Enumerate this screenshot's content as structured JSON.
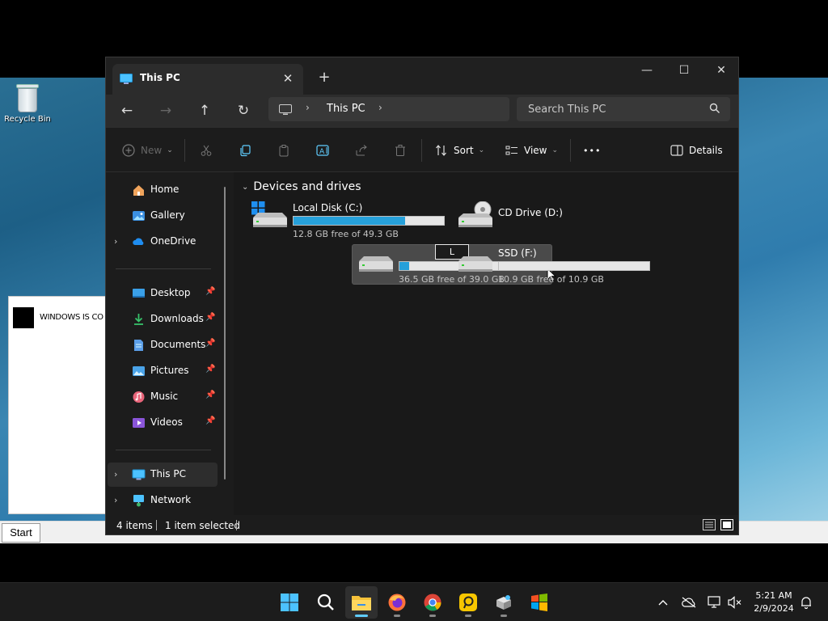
{
  "desktop": {
    "recycle_bin_label": "Recycle Bin",
    "bg_window_text": "WINDOWS IS CO",
    "start_button": "Start"
  },
  "window": {
    "tab_title": "This PC",
    "tab_close": "✕",
    "new_tab": "+",
    "minimize": "—",
    "maximize": "☐",
    "close": "✕"
  },
  "address": {
    "back": "←",
    "forward": "→",
    "up": "↑",
    "refresh": "↻",
    "chevron": "›",
    "breadcrumb": "This PC",
    "search_placeholder": "Search This PC"
  },
  "toolbar": {
    "new_label": "New",
    "sort_label": "Sort",
    "view_label": "View",
    "more_label": "•••",
    "details_label": "Details",
    "dropdown": "⌄"
  },
  "sidebar": {
    "items": [
      {
        "label": "Home",
        "icon": "home-icon"
      },
      {
        "label": "Gallery",
        "icon": "gallery-icon"
      },
      {
        "label": "OneDrive",
        "icon": "onedrive-icon"
      },
      {
        "label": "Desktop",
        "icon": "desktop-folder-icon",
        "pinned": true
      },
      {
        "label": "Downloads",
        "icon": "downloads-icon",
        "pinned": true
      },
      {
        "label": "Documents",
        "icon": "documents-icon",
        "pinned": true
      },
      {
        "label": "Pictures",
        "icon": "pictures-icon",
        "pinned": true
      },
      {
        "label": "Music",
        "icon": "music-icon",
        "pinned": true
      },
      {
        "label": "Videos",
        "icon": "videos-icon",
        "pinned": true
      },
      {
        "label": "This PC",
        "icon": "this-pc-icon",
        "selected": true
      },
      {
        "label": "Network",
        "icon": "network-icon"
      }
    ],
    "expander": "›",
    "pin": "📌"
  },
  "content": {
    "group_title": "Devices and drives",
    "group_chevron": "⌄",
    "drives": [
      {
        "name": "Local Disk (C:)",
        "free_text": "12.8 GB free of 49.3 GB",
        "used_fraction": 0.74,
        "icon": "windows-drive-icon"
      },
      {
        "name": "CD Drive (D:)",
        "free_text": "",
        "icon": "cd-drive-icon"
      },
      {
        "name": "",
        "rename_value": "L",
        "free_text": "36.5 GB free of 39.0 GB",
        "used_fraction": 0.064,
        "icon": "hard-drive-icon",
        "selected": true
      },
      {
        "name": "SSD (F:)",
        "free_text": "10.9 GB free of 10.9 GB",
        "used_fraction": 0.0,
        "icon": "hard-drive-icon"
      }
    ]
  },
  "status": {
    "item_count": "4 items",
    "selection": "1 item selected"
  },
  "taskbar": {
    "apps": [
      "start-icon",
      "search-icon",
      "file-explorer-icon",
      "firefox-icon",
      "chrome-icon",
      "yellow-app-icon",
      "installer-icon",
      "windows-flag-icon"
    ],
    "time": "5:21 AM",
    "date": "2/9/2024"
  },
  "colors": {
    "accent": "#26a0da",
    "window_bg": "#191919",
    "taskbar_bg": "#1c1c1c"
  }
}
